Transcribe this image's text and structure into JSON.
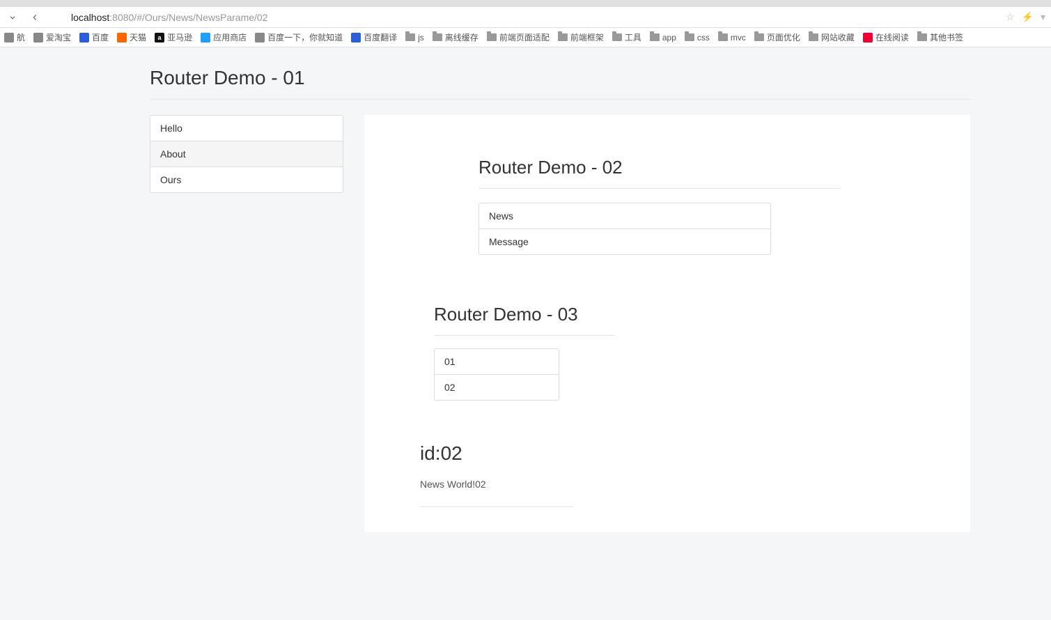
{
  "browser": {
    "url_dark": "localhost",
    "url_rest": ":8080/#/Ours/News/NewsParame/02"
  },
  "bookmarks": [
    {
      "label": "航",
      "icon": "gray"
    },
    {
      "label": "爱淘宝",
      "icon": "gray"
    },
    {
      "label": "百度",
      "icon": "blue"
    },
    {
      "label": "天猫",
      "icon": "orange"
    },
    {
      "label": "亚马逊",
      "icon": "black",
      "letter": "a"
    },
    {
      "label": "应用商店",
      "icon": "cyan"
    },
    {
      "label": "百度一下，你就知道",
      "icon": "gray"
    },
    {
      "label": "百度翻译",
      "icon": "blue"
    },
    {
      "label": "js",
      "icon": "folder"
    },
    {
      "label": "离线缓存",
      "icon": "folder"
    },
    {
      "label": "前端页面适配",
      "icon": "folder"
    },
    {
      "label": "前端框架",
      "icon": "folder"
    },
    {
      "label": "工具",
      "icon": "folder"
    },
    {
      "label": "app",
      "icon": "folder"
    },
    {
      "label": "css",
      "icon": "folder"
    },
    {
      "label": "mvc",
      "icon": "folder"
    },
    {
      "label": "页面优化",
      "icon": "folder"
    },
    {
      "label": "网站收藏",
      "icon": "folder"
    },
    {
      "label": "在线阅读",
      "icon": "red"
    },
    {
      "label": "其他书签",
      "icon": "folder"
    }
  ],
  "page": {
    "title": "Router Demo - 01",
    "nav1": [
      "Hello",
      "About",
      "Ours"
    ],
    "nav1_active": 1,
    "title2": "Router Demo - 02",
    "nav2": [
      "News",
      "Message"
    ],
    "title3": "Router Demo - 03",
    "nav3": [
      "01",
      "02"
    ],
    "detail_title": "id:02",
    "detail_text": "News World!02"
  }
}
